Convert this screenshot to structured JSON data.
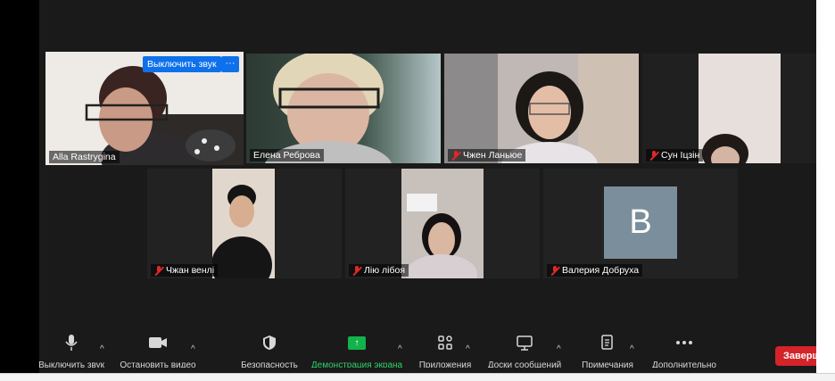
{
  "participants": [
    {
      "name": "Alla Rastrygina",
      "muted": false
    },
    {
      "name": "Елена Реброва",
      "muted": false
    },
    {
      "name": "Чжен Ланьюе",
      "muted": true
    },
    {
      "name": "Сун Іцзін",
      "muted": true
    },
    {
      "name": "Чжан венлі",
      "muted": true
    },
    {
      "name": "Лію лібоя",
      "muted": true
    },
    {
      "name": "Валерия Добруха",
      "muted": true,
      "avatar_letter": "B"
    }
  ],
  "active_tile": {
    "unmute_label": "Выключить звук",
    "more_label": "···"
  },
  "toolbar": {
    "mute_label": "Выключить звук",
    "video_label": "Остановить видео",
    "security_label": "Безопасность",
    "share_label": "Демонстрация экрана",
    "participants_label": "Приложения",
    "chat_label": "Доски сообщений",
    "notes_label": "Примечания",
    "more_label": "Дополнительно",
    "caret": "^",
    "end_label": "Заверш"
  },
  "colors": {
    "active_speaker": "#d3e64c",
    "share_green": "#12b34b",
    "end_red": "#d3242a",
    "unmute_blue": "#0e71eb",
    "avatar_grey": "#7b8e9b"
  }
}
